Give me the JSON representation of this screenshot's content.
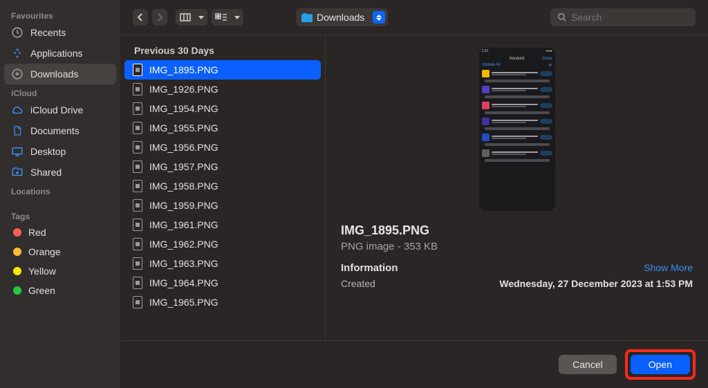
{
  "sidebar": {
    "sections": {
      "favourites": {
        "label": "Favourites",
        "items": [
          {
            "name": "recents",
            "label": "Recents"
          },
          {
            "name": "applications",
            "label": "Applications"
          },
          {
            "name": "downloads",
            "label": "Downloads",
            "active": true
          }
        ]
      },
      "icloud": {
        "label": "iCloud",
        "items": [
          {
            "name": "icloud-drive",
            "label": "iCloud Drive"
          },
          {
            "name": "documents",
            "label": "Documents"
          },
          {
            "name": "desktop",
            "label": "Desktop"
          },
          {
            "name": "shared",
            "label": "Shared"
          }
        ]
      },
      "locations": {
        "label": "Locations"
      },
      "tags": {
        "label": "Tags",
        "items": [
          {
            "color": "#ff5f56",
            "label": "Red"
          },
          {
            "color": "#ffbd2e",
            "label": "Orange"
          },
          {
            "color": "#ffe600",
            "label": "Yellow"
          },
          {
            "color": "#27c93f",
            "label": "Green"
          }
        ]
      }
    }
  },
  "toolbar": {
    "path_label": "Downloads",
    "search_placeholder": "Search"
  },
  "file_list": {
    "section_label": "Previous 30 Days",
    "items": [
      "IMG_1895.PNG",
      "IMG_1926.PNG",
      "IMG_1954.PNG",
      "IMG_1955.PNG",
      "IMG_1956.PNG",
      "IMG_1957.PNG",
      "IMG_1958.PNG",
      "IMG_1959.PNG",
      "IMG_1961.PNG",
      "IMG_1962.PNG",
      "IMG_1963.PNG",
      "IMG_1964.PNG",
      "IMG_1965.PNG"
    ],
    "selected_index": 0
  },
  "preview": {
    "filename": "IMG_1895.PNG",
    "subtitle": "PNG image - 353 KB",
    "info_label": "Information",
    "show_more": "Show More",
    "created_label": "Created",
    "created_value": "Wednesday, 27 December 2023 at 1:53 PM",
    "thumb": {
      "time": "1:53",
      "screen_title": "Account",
      "done": "Done",
      "update_header": "Update All",
      "apps": [
        "#f2b705",
        "#5040c0",
        "#e04060",
        "#4030a0",
        "#2050c0",
        "#606060"
      ]
    }
  },
  "footer": {
    "cancel": "Cancel",
    "open": "Open"
  }
}
